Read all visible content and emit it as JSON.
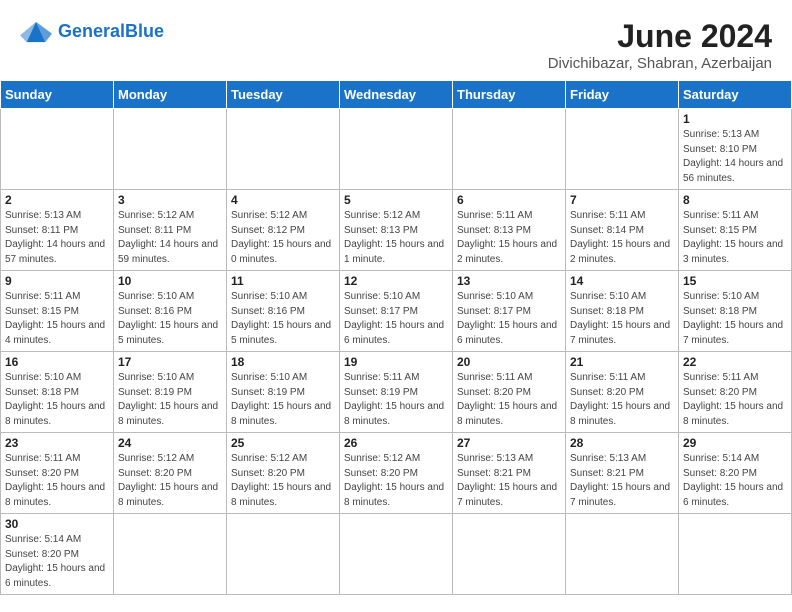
{
  "header": {
    "logo_general": "General",
    "logo_blue": "Blue",
    "month_year": "June 2024",
    "location": "Divichibazar, Shabran, Azerbaijan"
  },
  "weekdays": [
    "Sunday",
    "Monday",
    "Tuesday",
    "Wednesday",
    "Thursday",
    "Friday",
    "Saturday"
  ],
  "weeks": [
    [
      {
        "day": "",
        "info": "",
        "empty": true
      },
      {
        "day": "",
        "info": "",
        "empty": true
      },
      {
        "day": "",
        "info": "",
        "empty": true
      },
      {
        "day": "",
        "info": "",
        "empty": true
      },
      {
        "day": "",
        "info": "",
        "empty": true
      },
      {
        "day": "",
        "info": "",
        "empty": true
      },
      {
        "day": "1",
        "info": "Sunrise: 5:13 AM\nSunset: 8:10 PM\nDaylight: 14 hours\nand 56 minutes.",
        "empty": false
      }
    ],
    [
      {
        "day": "2",
        "info": "Sunrise: 5:13 AM\nSunset: 8:11 PM\nDaylight: 14 hours\nand 57 minutes.",
        "empty": false
      },
      {
        "day": "3",
        "info": "Sunrise: 5:12 AM\nSunset: 8:11 PM\nDaylight: 14 hours\nand 59 minutes.",
        "empty": false
      },
      {
        "day": "4",
        "info": "Sunrise: 5:12 AM\nSunset: 8:12 PM\nDaylight: 15 hours\nand 0 minutes.",
        "empty": false
      },
      {
        "day": "5",
        "info": "Sunrise: 5:12 AM\nSunset: 8:13 PM\nDaylight: 15 hours\nand 1 minute.",
        "empty": false
      },
      {
        "day": "6",
        "info": "Sunrise: 5:11 AM\nSunset: 8:13 PM\nDaylight: 15 hours\nand 2 minutes.",
        "empty": false
      },
      {
        "day": "7",
        "info": "Sunrise: 5:11 AM\nSunset: 8:14 PM\nDaylight: 15 hours\nand 2 minutes.",
        "empty": false
      },
      {
        "day": "8",
        "info": "Sunrise: 5:11 AM\nSunset: 8:15 PM\nDaylight: 15 hours\nand 3 minutes.",
        "empty": false
      }
    ],
    [
      {
        "day": "9",
        "info": "Sunrise: 5:11 AM\nSunset: 8:15 PM\nDaylight: 15 hours\nand 4 minutes.",
        "empty": false
      },
      {
        "day": "10",
        "info": "Sunrise: 5:10 AM\nSunset: 8:16 PM\nDaylight: 15 hours\nand 5 minutes.",
        "empty": false
      },
      {
        "day": "11",
        "info": "Sunrise: 5:10 AM\nSunset: 8:16 PM\nDaylight: 15 hours\nand 5 minutes.",
        "empty": false
      },
      {
        "day": "12",
        "info": "Sunrise: 5:10 AM\nSunset: 8:17 PM\nDaylight: 15 hours\nand 6 minutes.",
        "empty": false
      },
      {
        "day": "13",
        "info": "Sunrise: 5:10 AM\nSunset: 8:17 PM\nDaylight: 15 hours\nand 6 minutes.",
        "empty": false
      },
      {
        "day": "14",
        "info": "Sunrise: 5:10 AM\nSunset: 8:18 PM\nDaylight: 15 hours\nand 7 minutes.",
        "empty": false
      },
      {
        "day": "15",
        "info": "Sunrise: 5:10 AM\nSunset: 8:18 PM\nDaylight: 15 hours\nand 7 minutes.",
        "empty": false
      }
    ],
    [
      {
        "day": "16",
        "info": "Sunrise: 5:10 AM\nSunset: 8:18 PM\nDaylight: 15 hours\nand 8 minutes.",
        "empty": false
      },
      {
        "day": "17",
        "info": "Sunrise: 5:10 AM\nSunset: 8:19 PM\nDaylight: 15 hours\nand 8 minutes.",
        "empty": false
      },
      {
        "day": "18",
        "info": "Sunrise: 5:10 AM\nSunset: 8:19 PM\nDaylight: 15 hours\nand 8 minutes.",
        "empty": false
      },
      {
        "day": "19",
        "info": "Sunrise: 5:11 AM\nSunset: 8:19 PM\nDaylight: 15 hours\nand 8 minutes.",
        "empty": false
      },
      {
        "day": "20",
        "info": "Sunrise: 5:11 AM\nSunset: 8:20 PM\nDaylight: 15 hours\nand 8 minutes.",
        "empty": false
      },
      {
        "day": "21",
        "info": "Sunrise: 5:11 AM\nSunset: 8:20 PM\nDaylight: 15 hours\nand 8 minutes.",
        "empty": false
      },
      {
        "day": "22",
        "info": "Sunrise: 5:11 AM\nSunset: 8:20 PM\nDaylight: 15 hours\nand 8 minutes.",
        "empty": false
      }
    ],
    [
      {
        "day": "23",
        "info": "Sunrise: 5:11 AM\nSunset: 8:20 PM\nDaylight: 15 hours\nand 8 minutes.",
        "empty": false
      },
      {
        "day": "24",
        "info": "Sunrise: 5:12 AM\nSunset: 8:20 PM\nDaylight: 15 hours\nand 8 minutes.",
        "empty": false
      },
      {
        "day": "25",
        "info": "Sunrise: 5:12 AM\nSunset: 8:20 PM\nDaylight: 15 hours\nand 8 minutes.",
        "empty": false
      },
      {
        "day": "26",
        "info": "Sunrise: 5:12 AM\nSunset: 8:20 PM\nDaylight: 15 hours\nand 8 minutes.",
        "empty": false
      },
      {
        "day": "27",
        "info": "Sunrise: 5:13 AM\nSunset: 8:21 PM\nDaylight: 15 hours\nand 7 minutes.",
        "empty": false
      },
      {
        "day": "28",
        "info": "Sunrise: 5:13 AM\nSunset: 8:21 PM\nDaylight: 15 hours\nand 7 minutes.",
        "empty": false
      },
      {
        "day": "29",
        "info": "Sunrise: 5:14 AM\nSunset: 8:20 PM\nDaylight: 15 hours\nand 6 minutes.",
        "empty": false
      }
    ],
    [
      {
        "day": "30",
        "info": "Sunrise: 5:14 AM\nSunset: 8:20 PM\nDaylight: 15 hours\nand 6 minutes.",
        "empty": false
      },
      {
        "day": "",
        "info": "",
        "empty": true
      },
      {
        "day": "",
        "info": "",
        "empty": true
      },
      {
        "day": "",
        "info": "",
        "empty": true
      },
      {
        "day": "",
        "info": "",
        "empty": true
      },
      {
        "day": "",
        "info": "",
        "empty": true
      },
      {
        "day": "",
        "info": "",
        "empty": true
      }
    ]
  ]
}
